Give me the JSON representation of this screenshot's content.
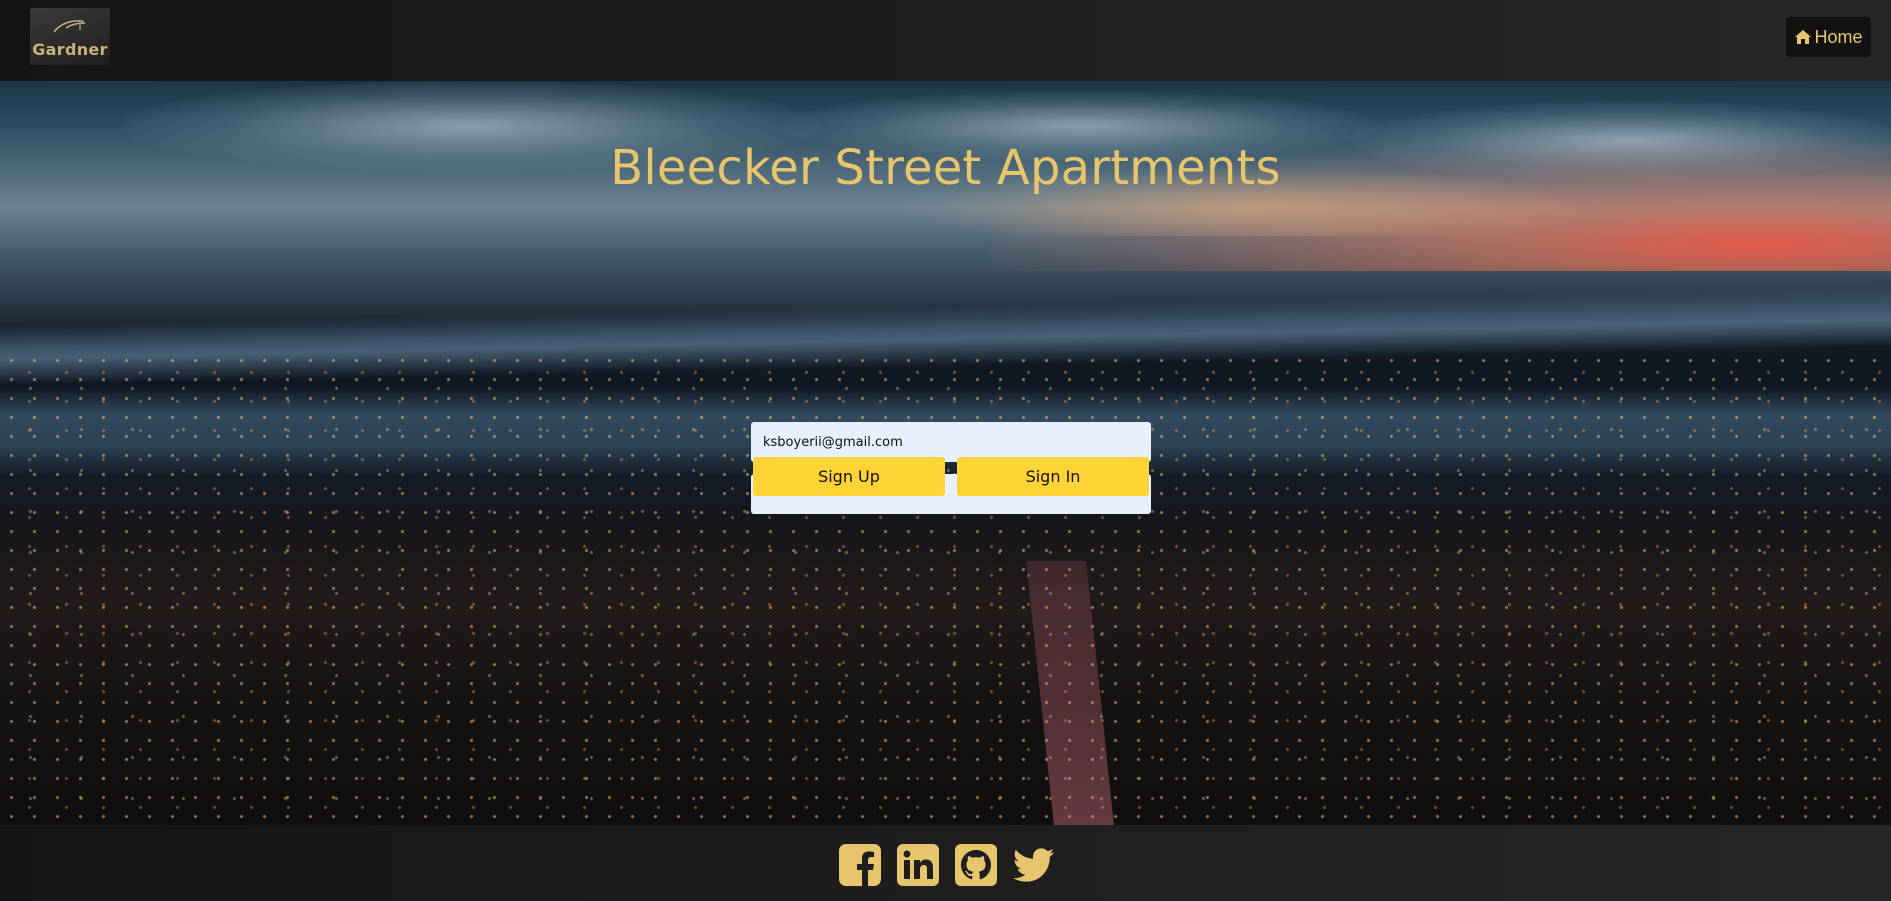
{
  "nav": {
    "logo_text": "Gardner",
    "home_label": "Home"
  },
  "hero": {
    "title": "Bleecker Street Apartments"
  },
  "form": {
    "email_value": "ksboyerii@gmail.com",
    "password_value": "••••••••••",
    "signup_label": "Sign Up",
    "signin_label": "Sign In"
  },
  "footer": {
    "icons": [
      "facebook-icon",
      "linkedin-icon",
      "github-icon",
      "twitter-icon"
    ]
  },
  "colors": {
    "accent_gold": "#e6c56d",
    "button_yellow": "#fdd335",
    "input_bg": "#e8effd",
    "nav_bg": "#1e1e1e"
  }
}
